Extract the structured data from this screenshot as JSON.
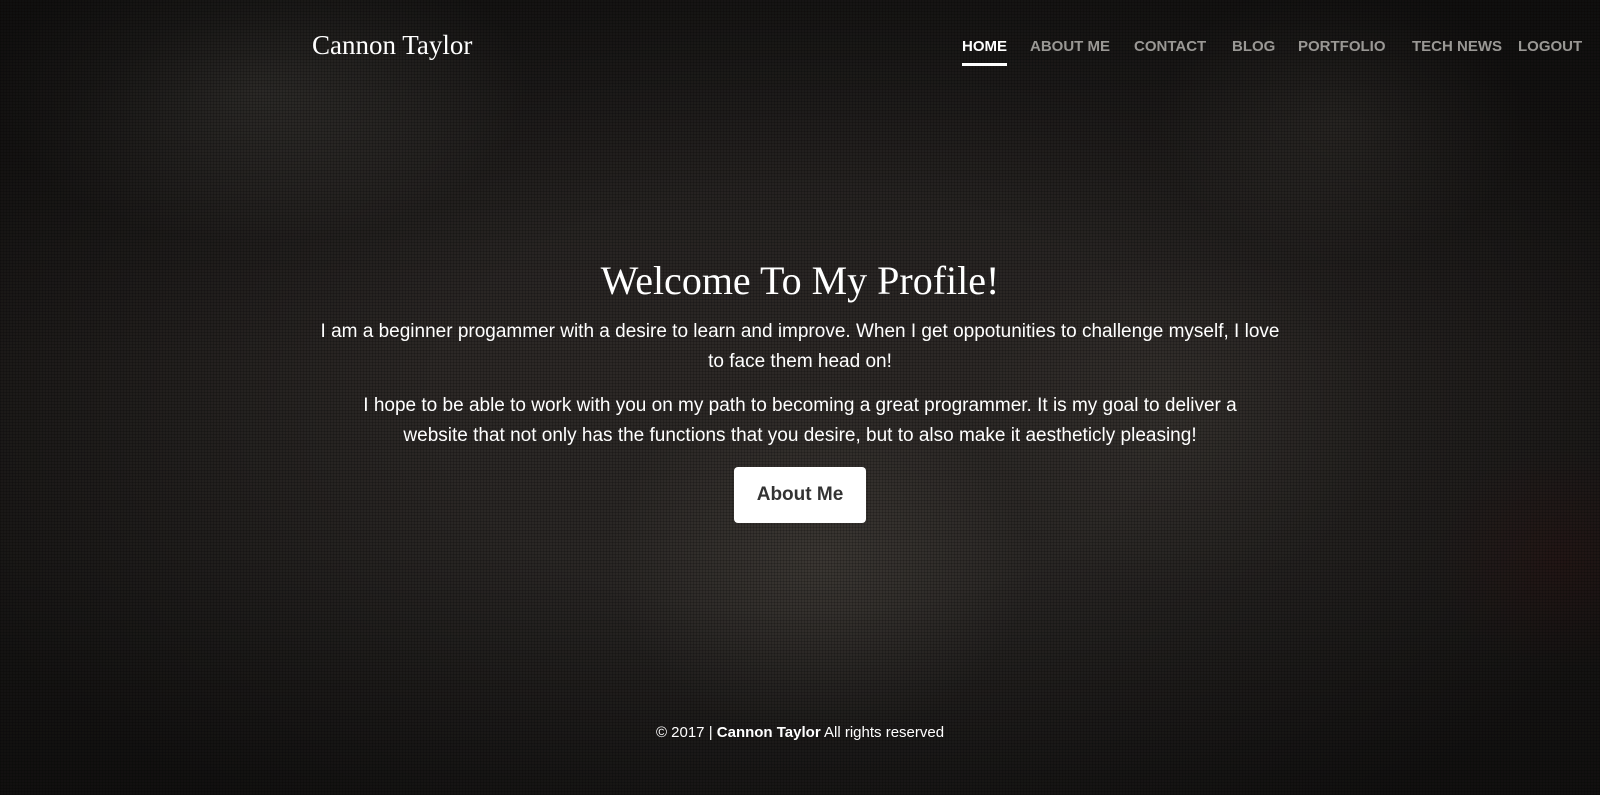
{
  "header": {
    "brand": "Cannon Taylor"
  },
  "nav": {
    "items": [
      {
        "label": "HOME",
        "active": true
      },
      {
        "label": "ABOUT ME",
        "active": false
      },
      {
        "label": "CONTACT",
        "active": false
      },
      {
        "label": "BLOG",
        "active": false
      },
      {
        "label": "PORTFOLIO",
        "active": false
      },
      {
        "label": "TECH NEWS",
        "active": false
      },
      {
        "label": "LOGOUT",
        "active": false
      }
    ]
  },
  "hero": {
    "title": "Welcome To My Profile!",
    "paragraph1": "I am a beginner progammer with a desire to learn and improve. When I get oppotunities to challenge myself, I love to face them head on!",
    "paragraph2": "I hope to be able to work with you on my path to becoming a great programmer. It is my goal to deliver a website that not only has the functions that you desire, but to also make it aestheticly pleasing!",
    "button_label": "About Me"
  },
  "footer": {
    "copyright": "© 2017 |",
    "name": "Cannon Taylor",
    "rights": "All rights reserved"
  }
}
